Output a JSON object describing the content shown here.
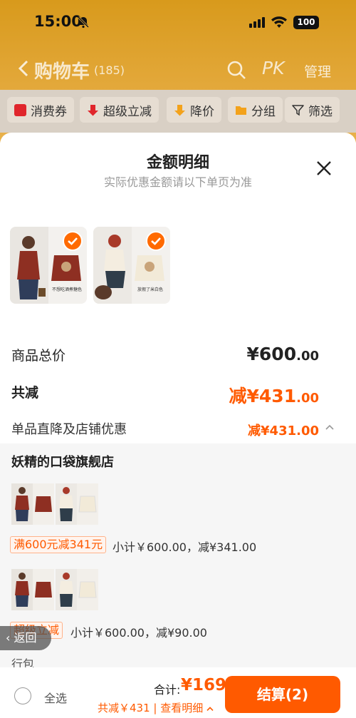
{
  "status_bar": {
    "time": "15:00",
    "battery": "100"
  },
  "cart_header": {
    "title": "购物车",
    "count": "(185)",
    "pk": "PK",
    "manage": "管理"
  },
  "filters": [
    {
      "label": "消费券",
      "icon": "coupon-icon",
      "color": "#e0262c"
    },
    {
      "label": "超级立减",
      "icon": "arrow-down-icon",
      "color": "#e0262c"
    },
    {
      "label": "降价",
      "icon": "price-drop-icon",
      "color": "#f3a21b"
    },
    {
      "label": "分组",
      "icon": "folder-icon",
      "color": "#f3a21b"
    },
    {
      "label": "筛选",
      "icon": "filter-icon",
      "color": "#333333"
    }
  ],
  "sheet": {
    "title": "金额明细",
    "subtitle": "实际优惠金额请以下单页为准",
    "products": [
      {
        "caption": "不想吃酒煮糖色"
      },
      {
        "caption": "放假了米白色"
      }
    ],
    "total_label": "商品总价",
    "total_value": "¥600",
    "total_decimal": ".00",
    "reduce_label": "共减",
    "reduce_value": "减¥431",
    "reduce_decimal": ".00",
    "detail_label": "单品直降及店铺优惠",
    "detail_value": "减¥431.00",
    "shop": {
      "name": "妖精的口袋旗舰店",
      "groups": [
        {
          "tag": "满600元减341元",
          "subtotal": "小计￥600.00，减¥341.00"
        },
        {
          "tag": "超级立减",
          "subtotal": "小计￥600.00，减¥90.00"
        }
      ],
      "partial_label": "行包"
    }
  },
  "back_float": "返回",
  "bottom": {
    "select_all": "全选",
    "sum_label": "合计:",
    "sum_value": "¥169",
    "saving": "共减￥431 | 查看明细",
    "checkout": "结算(2)"
  },
  "colors": {
    "accent": "#ff5a00",
    "header_gold": "#d89a1c"
  }
}
